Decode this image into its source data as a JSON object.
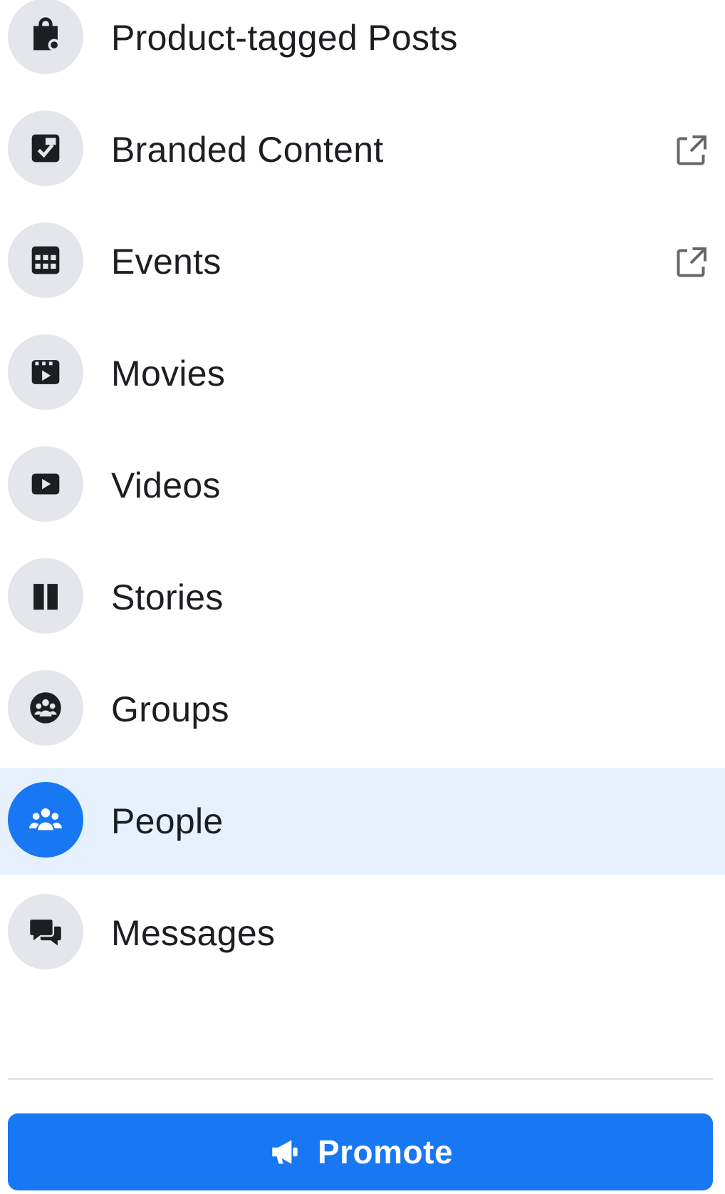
{
  "colors": {
    "accent": "#1877f2",
    "active_row_bg": "#e7f0fd",
    "icon_circle_bg": "#e4e6eb",
    "text": "#1c1e21"
  },
  "menu": {
    "items": [
      {
        "label": "Product-tagged Posts",
        "icon": "shopping-bag-tag-icon",
        "external": false,
        "active": false
      },
      {
        "label": "Branded Content",
        "icon": "branded-content-icon",
        "external": true,
        "active": false
      },
      {
        "label": "Events",
        "icon": "calendar-icon",
        "external": true,
        "active": false
      },
      {
        "label": "Movies",
        "icon": "clapperboard-icon",
        "external": false,
        "active": false
      },
      {
        "label": "Videos",
        "icon": "video-play-icon",
        "external": false,
        "active": false
      },
      {
        "label": "Stories",
        "icon": "book-icon",
        "external": false,
        "active": false
      },
      {
        "label": "Groups",
        "icon": "groups-icon",
        "external": false,
        "active": false
      },
      {
        "label": "People",
        "icon": "people-icon",
        "external": false,
        "active": true
      },
      {
        "label": "Messages",
        "icon": "chat-bubbles-icon",
        "external": false,
        "active": false
      }
    ]
  },
  "promote": {
    "label": "Promote",
    "icon": "megaphone-icon"
  }
}
